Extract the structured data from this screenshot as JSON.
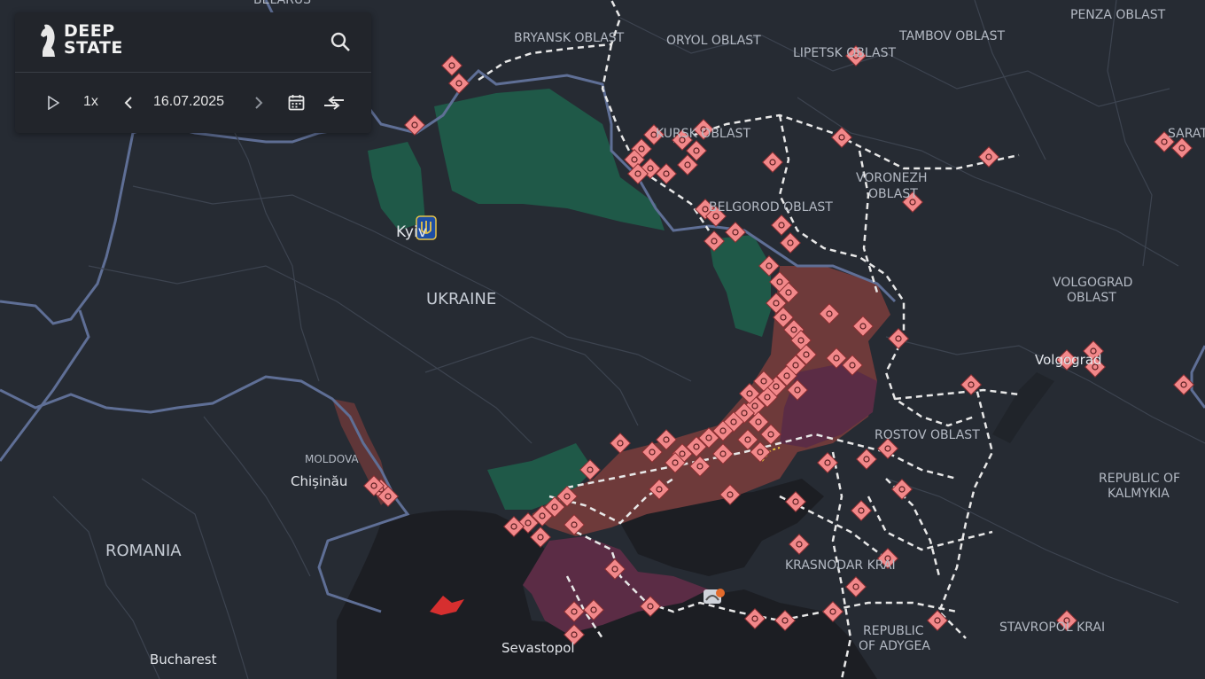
{
  "app": {
    "logo_line1": "DEEP",
    "logo_line2": "STATE"
  },
  "player": {
    "speed": "1x",
    "date": "16.07.2025"
  },
  "icons": {
    "search": "search-icon",
    "play": "play-icon",
    "prev": "chevron-left-icon",
    "next": "chevron-right-icon",
    "calendar": "calendar-icon",
    "compare": "compare-arrows-icon"
  },
  "colors": {
    "background": "#262b33",
    "sea": "#1c1e23",
    "occupied": "#6e3a3a",
    "crimea": "#5b2c45",
    "liberated": "#1f5e4a",
    "marker": "#f2888a",
    "border": "#5f6f96"
  },
  "labels": {
    "belarus": "BELARUS",
    "bryansk": "BRYANSK OBLAST",
    "oryol": "ORYOL OBLAST",
    "lipetsk": "LIPETSK OBLAST",
    "tambov": "TAMBOV OBLAST",
    "penza": "PENZA OBLAST",
    "kursk": "KURSK OBLAST",
    "saratov": "SARATOV",
    "voronezh1": "VORONEZH",
    "voronezh2": "OBLAST",
    "belgorod": "BELGOROD OBLAST",
    "kyiv": "Kyiv",
    "ukraine": "UKRAINE",
    "volgograd1": "VOLGOGRAD",
    "volgograd2": "OBLAST",
    "volgograd_city": "Volgograd",
    "rostov": "ROSTOV OBLAST",
    "kalmykia1": "REPUBLIC OF",
    "kalmykia2": "KALMYKIA",
    "moldova": "MOLDOVA",
    "chisinau": "Chișinău",
    "romania": "ROMANIA",
    "krasnodar": "KRASNODAR KRAI",
    "bucharest": "Bucharest",
    "sevastopol": "Sevastopol",
    "adygea1": "REPUBLIC",
    "adygea2": "OF ADYGEA",
    "stavropol": "STAVROPOL KRAI"
  }
}
